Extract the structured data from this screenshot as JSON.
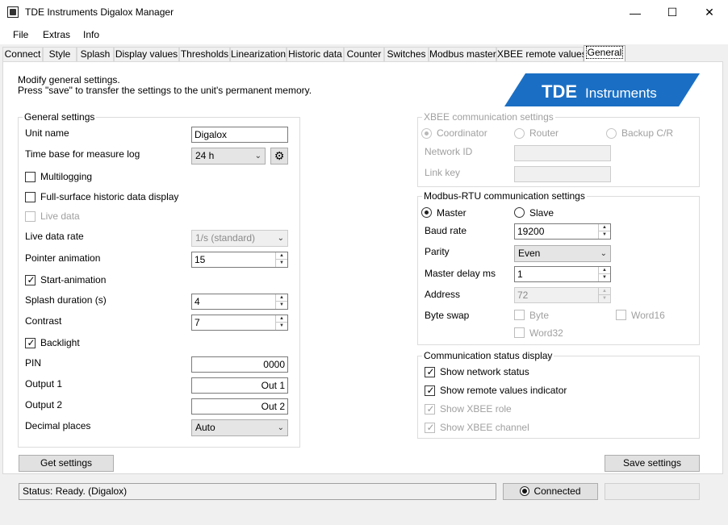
{
  "window": {
    "title": "TDE Instruments Digalox Manager",
    "min_glyph": "—",
    "max_glyph": "☐",
    "close_glyph": "✕"
  },
  "menu": [
    "File",
    "Extras",
    "Info"
  ],
  "tabs": [
    "Connect",
    "Style",
    "Splash",
    "Display values",
    "Thresholds",
    "Linearization",
    "Historic data",
    "Counter",
    "Switches",
    "Modbus master",
    "XBEE remote values",
    "General"
  ],
  "active_tab": "General",
  "intro": {
    "line1": "Modify general settings.",
    "line2": "Press \"save\" to transfer the settings to the unit's permanent memory."
  },
  "logo": {
    "text_bold": "TDE",
    "text_light": "Instruments",
    "color": "#1a6fc4"
  },
  "general_settings": {
    "title": "General settings",
    "unit_name_label": "Unit name",
    "unit_name_value": "Digalox",
    "time_base_label": "Time base for measure log",
    "time_base_value": "24 h",
    "multilogging_label": "Multilogging",
    "full_surface_label": "Full-surface historic data display",
    "live_data_label": "Live data",
    "live_data_rate_label": "Live data rate",
    "live_data_rate_value": "1/s (standard)",
    "pointer_animation_label": "Pointer animation",
    "pointer_animation_value": "15",
    "start_animation_label": "Start-animation",
    "splash_duration_label": "Splash duration (s)",
    "splash_duration_value": "4",
    "contrast_label": "Contrast",
    "contrast_value": "7",
    "backlight_label": "Backlight",
    "pin_label": "PIN",
    "pin_value": "0000",
    "output1_label": "Output 1",
    "output1_value": "Out 1",
    "output2_label": "Output 2",
    "output2_value": "Out 2",
    "decimal_places_label": "Decimal places",
    "decimal_places_value": "Auto"
  },
  "xbee": {
    "title": "XBEE communication settings",
    "coordinator_label": "Coordinator",
    "router_label": "Router",
    "backup_label": "Backup C/R",
    "network_id_label": "Network ID",
    "link_key_label": "Link key"
  },
  "modbus": {
    "title": "Modbus-RTU communication settings",
    "master_label": "Master",
    "slave_label": "Slave",
    "baud_rate_label": "Baud rate",
    "baud_rate_value": "19200",
    "parity_label": "Parity",
    "parity_value": "Even",
    "master_delay_label": "Master delay ms",
    "master_delay_value": "1",
    "address_label": "Address",
    "address_value": "72",
    "byte_swap_label": "Byte swap",
    "byte_label": "Byte",
    "word16_label": "Word16",
    "word32_label": "Word32"
  },
  "comm_status": {
    "title": "Communication status display",
    "show_network_status_label": "Show network status",
    "show_remote_values_label": "Show remote values indicator",
    "show_xbee_role_label": "Show XBEE role",
    "show_xbee_channel_label": "Show XBEE channel"
  },
  "buttons": {
    "get_settings": "Get settings",
    "save_settings": "Save settings"
  },
  "status": {
    "text": "Status: Ready. (Digalox)",
    "connected_label": "Connected"
  }
}
